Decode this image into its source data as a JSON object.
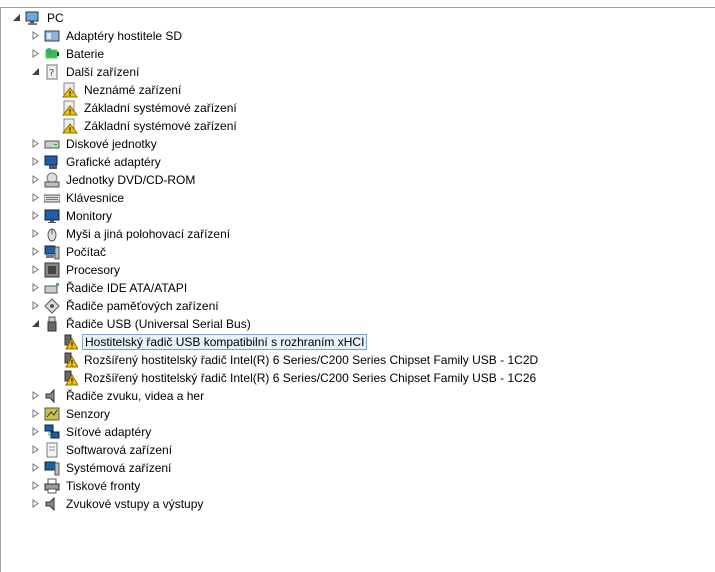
{
  "tree": {
    "root": "PC",
    "items": [
      {
        "label": "Adaptéry hostitele SD"
      },
      {
        "label": "Baterie"
      },
      {
        "label": "Další zařízení",
        "children": [
          "Neznámé zařízení",
          "Základní systémové zařízení",
          "Základní systémové zařízení"
        ]
      },
      {
        "label": "Diskové jednotky"
      },
      {
        "label": "Grafické adaptéry"
      },
      {
        "label": "Jednotky DVD/CD-ROM"
      },
      {
        "label": "Klávesnice"
      },
      {
        "label": "Monitory"
      },
      {
        "label": "Myši a jiná polohovací zařízení"
      },
      {
        "label": "Počítač"
      },
      {
        "label": "Procesory"
      },
      {
        "label": "Řadiče IDE ATA/ATAPI"
      },
      {
        "label": "Řadiče paměťových zařízení"
      },
      {
        "label": "Řadiče USB (Universal Serial Bus)",
        "children": [
          "Hostitelský řadič USB kompatibilní s rozhraním xHCI",
          "Rozšířený hostitelský řadič Intel(R) 6 Series/C200 Series Chipset Family USB - 1C2D",
          "Rozšířený hostitelský řadič Intel(R) 6 Series/C200 Series Chipset Family USB - 1C26"
        ]
      },
      {
        "label": "Řadiče zvuku, videa a her"
      },
      {
        "label": "Senzory"
      },
      {
        "label": "Síťové adaptéry"
      },
      {
        "label": "Softwarová zařízení"
      },
      {
        "label": "Systémová zařízení"
      },
      {
        "label": "Tiskové fronty"
      },
      {
        "label": "Zvukové vstupy a výstupy"
      }
    ]
  },
  "colors": {
    "selection_bg": "#e5f3fb",
    "selection_border": "#7da2ce",
    "warning": "#f2c200"
  }
}
